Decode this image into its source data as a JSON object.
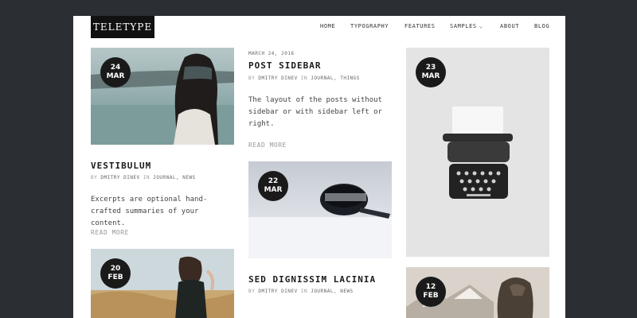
{
  "site": {
    "logo": "TELETYPE"
  },
  "nav": [
    {
      "label": "HOME"
    },
    {
      "label": "TYPOGRAPHY"
    },
    {
      "label": "FEATURES"
    },
    {
      "label": "SAMPLES"
    },
    {
      "label": "ABOUT"
    },
    {
      "label": "BLOG"
    }
  ],
  "posts": {
    "vestibulum": {
      "day": "24",
      "month": "MAR",
      "title": "VESTIBULUM",
      "by": "BY",
      "author": "DMITRY DINEV",
      "in": "IN",
      "cats": "JOURNAL, NEWS",
      "excerpt": "Excerpts are optional hand-crafted summaries of your content.",
      "readmore": "READ MORE"
    },
    "post_sidebar": {
      "date": "MARCH 24, 2016",
      "title": "POST SIDEBAR",
      "by": "BY",
      "author": "DMITRY DINEV",
      "in": "IN",
      "cats": "JOURNAL, THINGS",
      "excerpt": "The layout of the posts without sidebar or with sidebar left or right.",
      "readmore": "READ MORE"
    },
    "sed_dignissim": {
      "day": "22",
      "month": "MAR",
      "title": "SED DIGNISSIM LACINIA",
      "by": "BY",
      "author": "DMITRY DINEV",
      "in": "IN",
      "cats": "JOURNAL, NEWS"
    },
    "typewriter": {
      "day": "23",
      "month": "MAR"
    },
    "field": {
      "day": "20",
      "month": "FEB"
    },
    "mountain": {
      "day": "12",
      "month": "FEB"
    }
  }
}
